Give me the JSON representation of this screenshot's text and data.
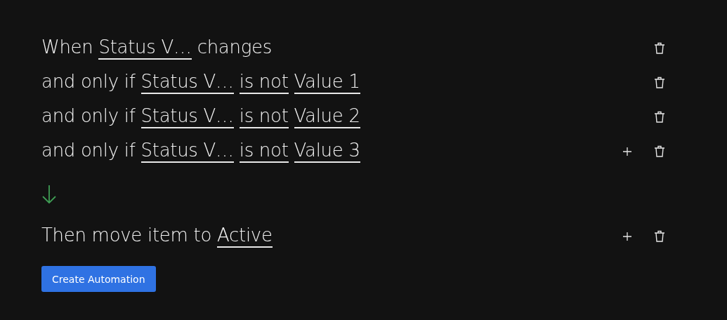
{
  "conditions": [
    {
      "parts": [
        {
          "kind": "text",
          "text": "When"
        },
        {
          "kind": "select",
          "text": "Status V…"
        },
        {
          "kind": "text",
          "text": "changes"
        }
      ],
      "add_button": false
    },
    {
      "parts": [
        {
          "kind": "text",
          "text": "and only if"
        },
        {
          "kind": "select",
          "text": "Status V…"
        },
        {
          "kind": "select",
          "text": "is not"
        },
        {
          "kind": "select",
          "text": "Value 1"
        }
      ],
      "add_button": false
    },
    {
      "parts": [
        {
          "kind": "text",
          "text": "and only if"
        },
        {
          "kind": "select",
          "text": "Status V…"
        },
        {
          "kind": "select",
          "text": "is not"
        },
        {
          "kind": "select",
          "text": "Value 2"
        }
      ],
      "add_button": false
    },
    {
      "parts": [
        {
          "kind": "text",
          "text": "and only if"
        },
        {
          "kind": "select",
          "text": "Status V…"
        },
        {
          "kind": "select",
          "text": "is not"
        },
        {
          "kind": "select",
          "text": "Value 3"
        }
      ],
      "add_button": true
    }
  ],
  "actions": [
    {
      "parts": [
        {
          "kind": "text",
          "text": "Then move item to"
        },
        {
          "kind": "select",
          "text": "Active"
        }
      ],
      "add_button": true
    }
  ],
  "create_button": {
    "label": "Create Automation"
  }
}
